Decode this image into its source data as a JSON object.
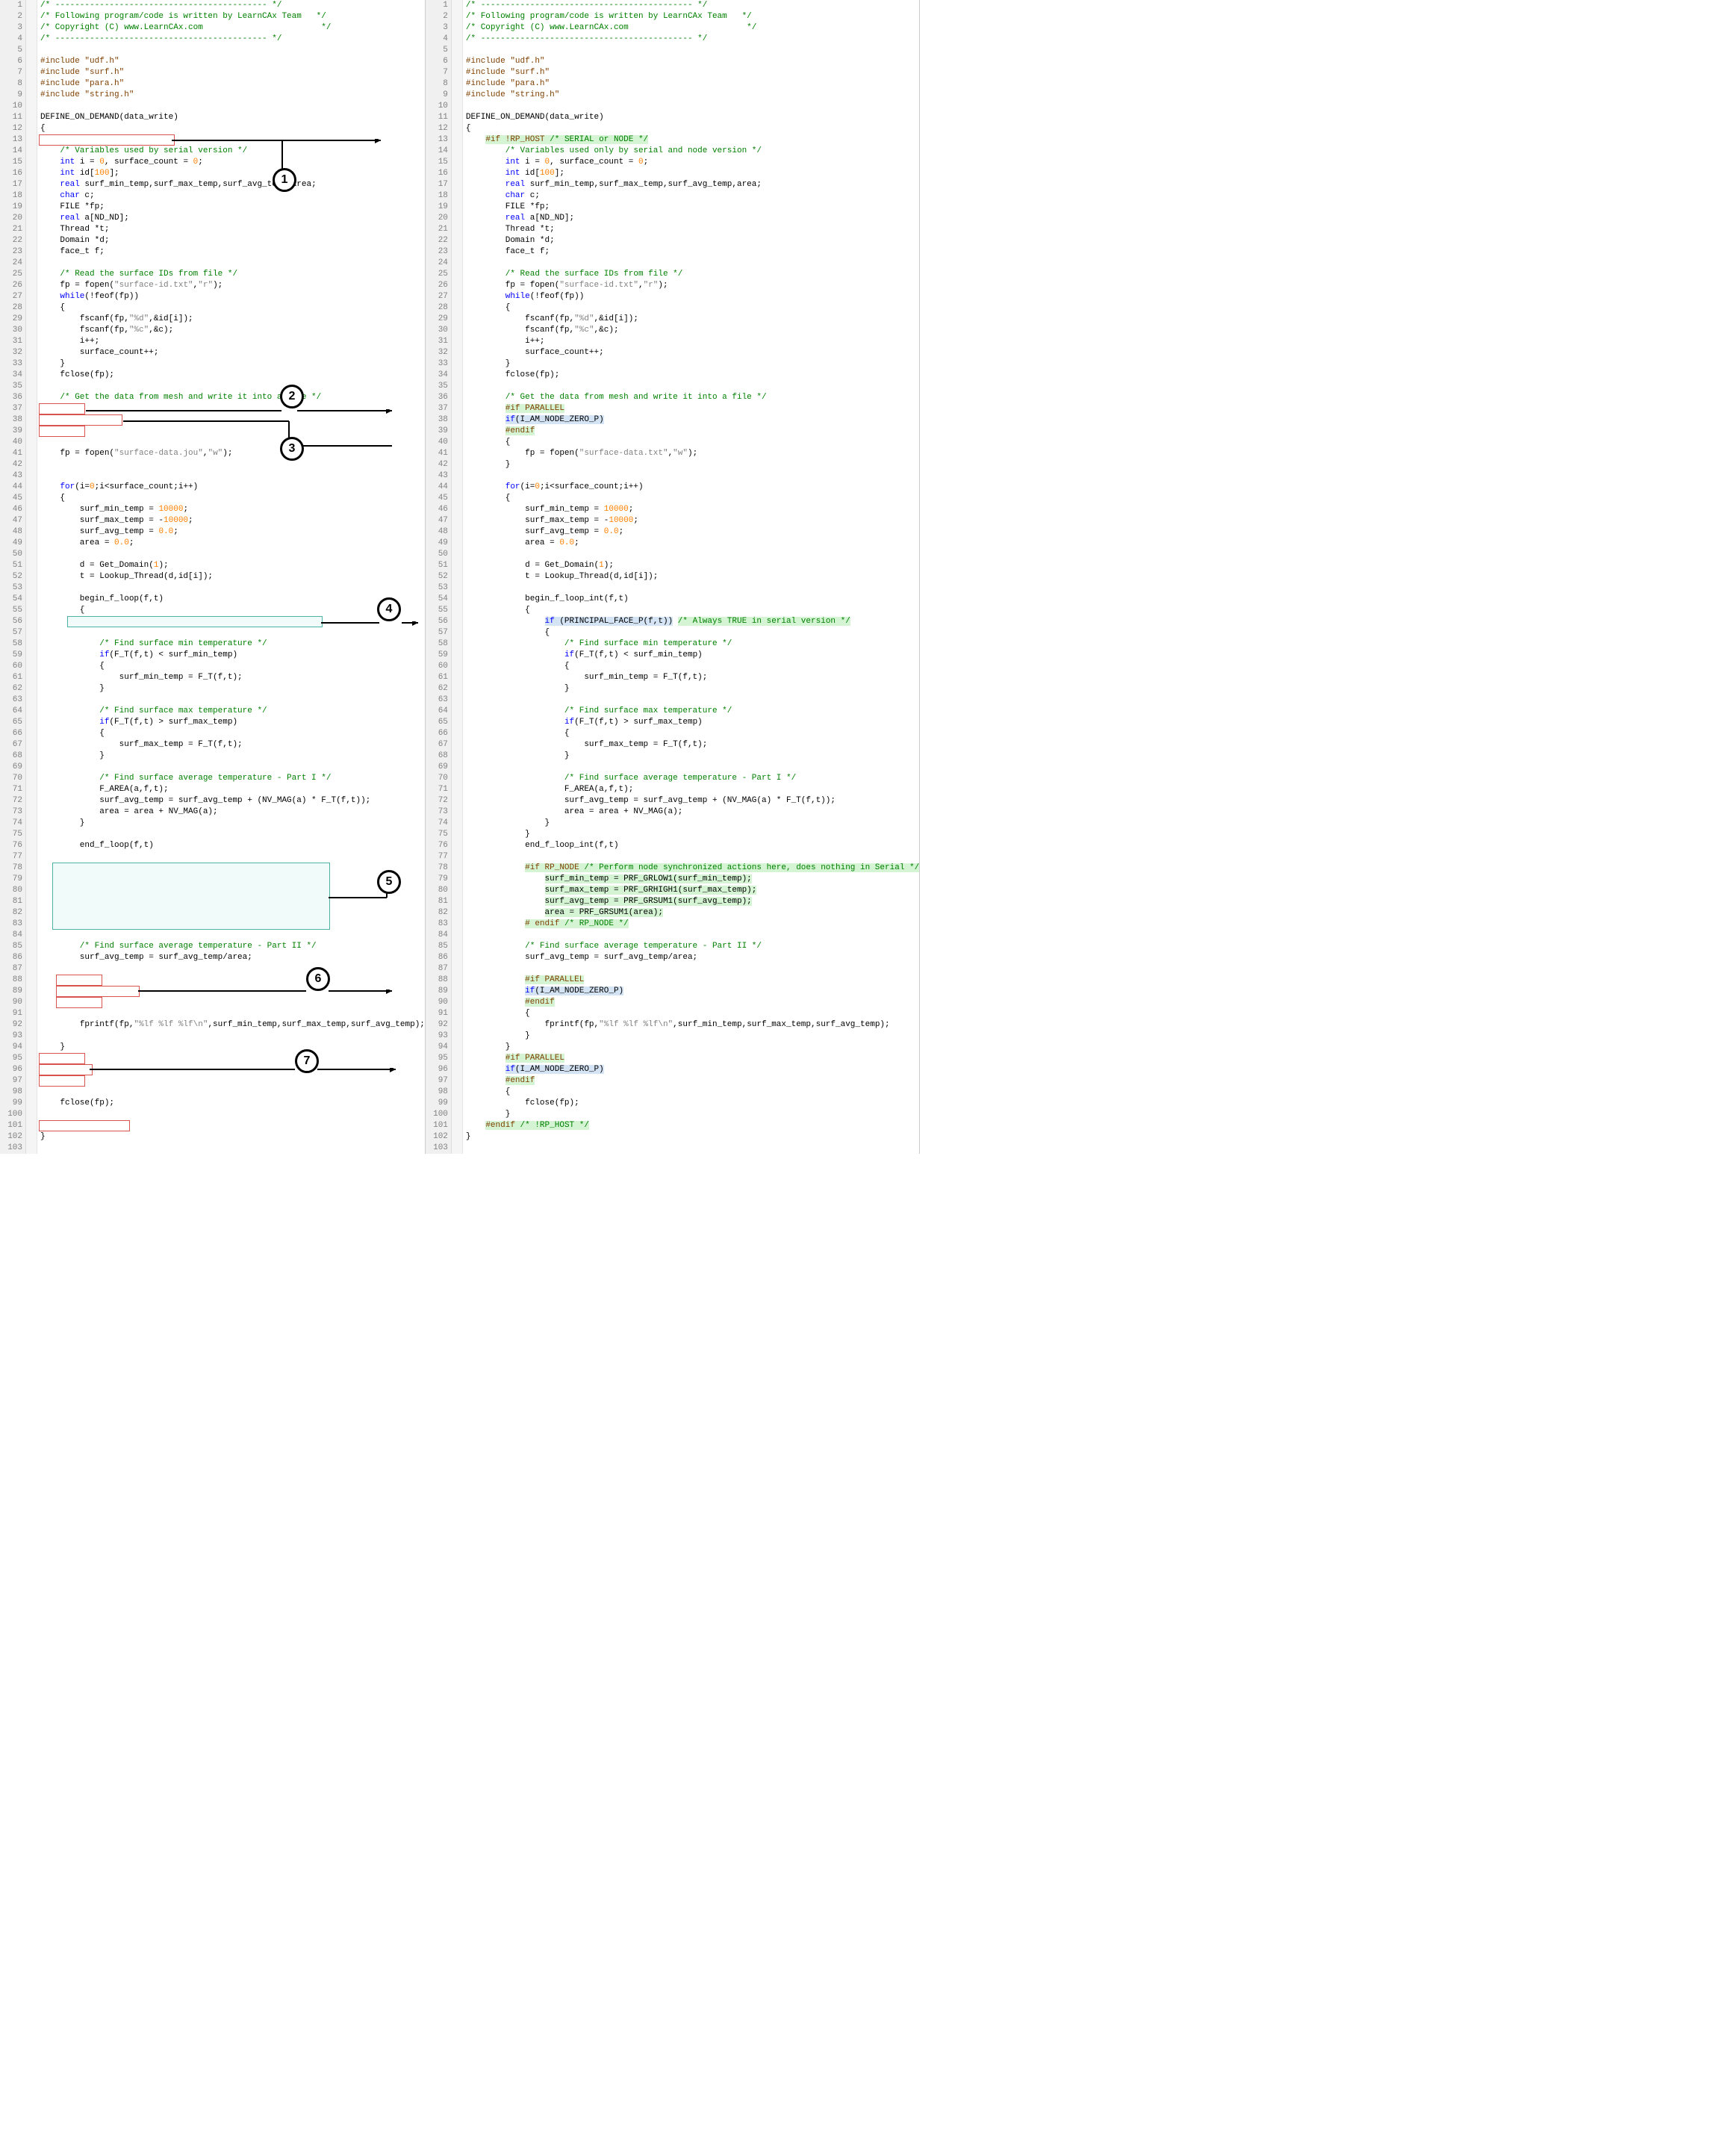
{
  "callouts": [
    "1",
    "2",
    "3",
    "4",
    "5",
    "6",
    "7"
  ],
  "left": [
    {
      "n": 1,
      "t": "/* ------------------------------------------- */",
      "cls": "c-cmt"
    },
    {
      "n": 2,
      "t": "/* Following program/code is written by LearnCAx Team   */",
      "cls": "c-cmt"
    },
    {
      "n": 3,
      "t": "/* Copyright (C) www.LearnCAx.com                        */",
      "cls": "c-cmt"
    },
    {
      "n": 4,
      "t": "/* ------------------------------------------- */",
      "cls": "c-cmt"
    },
    {
      "n": 5,
      "t": ""
    },
    {
      "n": 6,
      "t": "#include \"udf.h\"",
      "cls": "c-pp"
    },
    {
      "n": 7,
      "t": "#include \"surf.h\"",
      "cls": "c-pp"
    },
    {
      "n": 8,
      "t": "#include \"para.h\"",
      "cls": "c-pp"
    },
    {
      "n": 9,
      "t": "#include \"string.h\"",
      "cls": "c-pp"
    },
    {
      "n": 10,
      "t": ""
    },
    {
      "n": 11,
      "t": "DEFINE_ON_DEMAND(data_write)"
    },
    {
      "n": 12,
      "t": "{"
    },
    {
      "n": 13,
      "t": "",
      "box": "red"
    },
    {
      "n": 14,
      "t": "    /* Variables used by serial version */",
      "cls": "c-cmt"
    },
    {
      "n": 15,
      "h": "    <span class='c-kw'>int</span> i = <span class='c-num'>0</span>, surface_count = <span class='c-num'>0</span>;"
    },
    {
      "n": 16,
      "h": "    <span class='c-kw'>int</span> id[<span class='c-num'>100</span>];"
    },
    {
      "n": 17,
      "h": "    <span class='c-kw'>real</span> surf_min_temp,surf_max_temp,surf_avg_temp,area;"
    },
    {
      "n": 18,
      "h": "    <span class='c-kw'>char</span> c;"
    },
    {
      "n": 19,
      "t": "    FILE *fp;"
    },
    {
      "n": 20,
      "h": "    <span class='c-kw'>real</span> a[ND_ND];"
    },
    {
      "n": 21,
      "t": "    Thread *t;"
    },
    {
      "n": 22,
      "t": "    Domain *d;"
    },
    {
      "n": 23,
      "t": "    face_t f;"
    },
    {
      "n": 24,
      "t": ""
    },
    {
      "n": 25,
      "t": "    /* Read the surface IDs from file */",
      "cls": "c-cmt"
    },
    {
      "n": 26,
      "h": "    fp = fopen(<span class='c-str'>\"surface-id.txt\"</span>,<span class='c-str'>\"r\"</span>);"
    },
    {
      "n": 27,
      "h": "    <span class='c-kw'>while</span>(!feof(fp))"
    },
    {
      "n": 28,
      "t": "    {"
    },
    {
      "n": 29,
      "h": "        fscanf(fp,<span class='c-str'>\"%d\"</span>,&id[i]);"
    },
    {
      "n": 30,
      "h": "        fscanf(fp,<span class='c-str'>\"%c\"</span>,&c);"
    },
    {
      "n": 31,
      "t": "        i++;"
    },
    {
      "n": 32,
      "t": "        surface_count++;"
    },
    {
      "n": 33,
      "t": "    }"
    },
    {
      "n": 34,
      "t": "    fclose(fp);"
    },
    {
      "n": 35,
      "t": ""
    },
    {
      "n": 36,
      "t": "    /* Get the data from mesh and write it into a file */",
      "cls": "c-cmt"
    },
    {
      "n": 37,
      "t": "",
      "box": "red"
    },
    {
      "n": 38,
      "t": "",
      "box": "red"
    },
    {
      "n": 39,
      "t": "",
      "box": "red"
    },
    {
      "n": 40,
      "t": ""
    },
    {
      "n": 41,
      "h": "    fp = fopen(<span class='c-str'>\"surface-data.jou\"</span>,<span class='c-str'>\"w\"</span>);"
    },
    {
      "n": 42,
      "t": ""
    },
    {
      "n": 43,
      "t": ""
    },
    {
      "n": 44,
      "h": "    <span class='c-kw'>for</span>(i=<span class='c-num'>0</span>;i&lt;surface_count;i++)"
    },
    {
      "n": 45,
      "t": "    {"
    },
    {
      "n": 46,
      "h": "        surf_min_temp = <span class='c-num'>10000</span>;"
    },
    {
      "n": 47,
      "h": "        surf_max_temp = -<span class='c-num'>10000</span>;"
    },
    {
      "n": 48,
      "h": "        surf_avg_temp = <span class='c-num'>0.0</span>;"
    },
    {
      "n": 49,
      "h": "        area = <span class='c-num'>0.0</span>;"
    },
    {
      "n": 50,
      "t": ""
    },
    {
      "n": 51,
      "h": "        d = Get_Domain(<span class='c-num'>1</span>);"
    },
    {
      "n": 52,
      "t": "        t = Lookup_Thread(d,id[i]);"
    },
    {
      "n": 53,
      "t": ""
    },
    {
      "n": 54,
      "t": "        begin_f_loop(f,t)"
    },
    {
      "n": 55,
      "t": "        {"
    },
    {
      "n": 56,
      "t": "",
      "teal": 1
    },
    {
      "n": 57,
      "t": ""
    },
    {
      "n": 58,
      "t": "            /* Find surface min temperature */",
      "cls": "c-cmt"
    },
    {
      "n": 59,
      "h": "            <span class='c-kw'>if</span>(F_T(f,t) &lt; surf_min_temp)"
    },
    {
      "n": 60,
      "t": "            {"
    },
    {
      "n": 61,
      "t": "                surf_min_temp = F_T(f,t);"
    },
    {
      "n": 62,
      "t": "            }"
    },
    {
      "n": 63,
      "t": ""
    },
    {
      "n": 64,
      "t": "            /* Find surface max temperature */",
      "cls": "c-cmt"
    },
    {
      "n": 65,
      "h": "            <span class='c-kw'>if</span>(F_T(f,t) &gt; surf_max_temp)"
    },
    {
      "n": 66,
      "t": "            {"
    },
    {
      "n": 67,
      "t": "                surf_max_temp = F_T(f,t);"
    },
    {
      "n": 68,
      "t": "            }"
    },
    {
      "n": 69,
      "t": ""
    },
    {
      "n": 70,
      "t": "            /* Find surface average temperature - Part I */",
      "cls": "c-cmt"
    },
    {
      "n": 71,
      "t": "            F_AREA(a,f,t);"
    },
    {
      "n": 72,
      "t": "            surf_avg_temp = surf_avg_temp + (NV_MAG(a) * F_T(f,t));"
    },
    {
      "n": 73,
      "t": "            area = area + NV_MAG(a);"
    },
    {
      "n": 74,
      "t": "        }"
    },
    {
      "n": 75,
      "t": ""
    },
    {
      "n": 76,
      "t": "        end_f_loop(f,t)"
    },
    {
      "n": 77,
      "t": ""
    },
    {
      "n": 78,
      "t": "",
      "teal": 1
    },
    {
      "n": 79,
      "t": ""
    },
    {
      "n": 80,
      "t": ""
    },
    {
      "n": 81,
      "t": ""
    },
    {
      "n": 82,
      "t": ""
    },
    {
      "n": 83,
      "t": ""
    },
    {
      "n": 84,
      "t": ""
    },
    {
      "n": 85,
      "t": "        /* Find surface average temperature - Part II */",
      "cls": "c-cmt"
    },
    {
      "n": 86,
      "t": "        surf_avg_temp = surf_avg_temp/area;"
    },
    {
      "n": 87,
      "t": ""
    },
    {
      "n": 88,
      "t": "",
      "box": "red"
    },
    {
      "n": 89,
      "t": "",
      "box": "red"
    },
    {
      "n": 90,
      "t": "",
      "box": "red"
    },
    {
      "n": 91,
      "t": ""
    },
    {
      "n": 92,
      "h": "        fprintf(fp,<span class='c-str'>\"%lf %lf %lf\\n\"</span>,surf_min_temp,surf_max_temp,surf_avg_temp);"
    },
    {
      "n": 93,
      "t": ""
    },
    {
      "n": 94,
      "t": "    }"
    },
    {
      "n": 95,
      "t": "",
      "box": "red"
    },
    {
      "n": 96,
      "t": "",
      "box": "red"
    },
    {
      "n": 97,
      "t": "",
      "box": "red"
    },
    {
      "n": 98,
      "t": ""
    },
    {
      "n": 99,
      "t": "    fclose(fp);"
    },
    {
      "n": 100,
      "t": ""
    },
    {
      "n": 101,
      "t": "",
      "box": "red"
    },
    {
      "n": 102,
      "t": "}"
    },
    {
      "n": 103,
      "t": ""
    }
  ],
  "right": [
    {
      "n": 1,
      "t": "/* ------------------------------------------- */",
      "cls": "c-cmt"
    },
    {
      "n": 2,
      "t": "/* Following program/code is written by LearnCAx Team   */",
      "cls": "c-cmt"
    },
    {
      "n": 3,
      "t": "/* Copyright (C) www.LearnCAx.com                        */",
      "cls": "c-cmt"
    },
    {
      "n": 4,
      "t": "/* ------------------------------------------- */",
      "cls": "c-cmt"
    },
    {
      "n": 5,
      "t": ""
    },
    {
      "n": 6,
      "t": "#include \"udf.h\"",
      "cls": "c-pp"
    },
    {
      "n": 7,
      "t": "#include \"surf.h\"",
      "cls": "c-pp"
    },
    {
      "n": 8,
      "t": "#include \"para.h\"",
      "cls": "c-pp"
    },
    {
      "n": 9,
      "t": "#include \"string.h\"",
      "cls": "c-pp"
    },
    {
      "n": 10,
      "t": ""
    },
    {
      "n": 11,
      "t": "DEFINE_ON_DEMAND(data_write)"
    },
    {
      "n": 12,
      "t": "{"
    },
    {
      "n": 13,
      "h": "    <span class='hl-g'>#if !RP_HOST <span class='c-cmt'>/* SERIAL or NODE */</span></span>",
      "cls": "c-pp"
    },
    {
      "n": 14,
      "t": "        /* Variables used only by serial and node version */",
      "cls": "c-cmt"
    },
    {
      "n": 15,
      "h": "        <span class='c-kw'>int</span> i = <span class='c-num'>0</span>, surface_count = <span class='c-num'>0</span>;"
    },
    {
      "n": 16,
      "h": "        <span class='c-kw'>int</span> id[<span class='c-num'>100</span>];"
    },
    {
      "n": 17,
      "h": "        <span class='c-kw'>real</span> surf_min_temp,surf_max_temp,surf_avg_temp,area;"
    },
    {
      "n": 18,
      "h": "        <span class='c-kw'>char</span> c;"
    },
    {
      "n": 19,
      "t": "        FILE *fp;"
    },
    {
      "n": 20,
      "h": "        <span class='c-kw'>real</span> a[ND_ND];"
    },
    {
      "n": 21,
      "t": "        Thread *t;"
    },
    {
      "n": 22,
      "t": "        Domain *d;"
    },
    {
      "n": 23,
      "t": "        face_t f;"
    },
    {
      "n": 24,
      "t": ""
    },
    {
      "n": 25,
      "t": "        /* Read the surface IDs from file */",
      "cls": "c-cmt"
    },
    {
      "n": 26,
      "h": "        fp = fopen(<span class='c-str'>\"surface-id.txt\"</span>,<span class='c-str'>\"r\"</span>);"
    },
    {
      "n": 27,
      "h": "        <span class='c-kw'>while</span>(!feof(fp))"
    },
    {
      "n": 28,
      "t": "        {"
    },
    {
      "n": 29,
      "h": "            fscanf(fp,<span class='c-str'>\"%d\"</span>,&id[i]);"
    },
    {
      "n": 30,
      "h": "            fscanf(fp,<span class='c-str'>\"%c\"</span>,&c);"
    },
    {
      "n": 31,
      "t": "            i++;"
    },
    {
      "n": 32,
      "t": "            surface_count++;"
    },
    {
      "n": 33,
      "t": "        }"
    },
    {
      "n": 34,
      "t": "        fclose(fp);"
    },
    {
      "n": 35,
      "t": ""
    },
    {
      "n": 36,
      "t": "        /* Get the data from mesh and write it into a file */",
      "cls": "c-cmt"
    },
    {
      "n": 37,
      "h": "        <span class='hl-g'>#if PARALLEL</span>",
      "cls": "c-pp"
    },
    {
      "n": 38,
      "h": "        <span class='hl-b'><span class='c-kw'>if</span>(I_AM_NODE_ZERO_P)</span>"
    },
    {
      "n": 39,
      "h": "        <span class='hl-g'>#endif</span>",
      "cls": "c-pp"
    },
    {
      "n": 40,
      "t": "        {"
    },
    {
      "n": 41,
      "h": "            fp = fopen(<span class='c-str'>\"surface-data.txt\"</span>,<span class='c-str'>\"w\"</span>);"
    },
    {
      "n": 42,
      "t": "        }"
    },
    {
      "n": 43,
      "t": ""
    },
    {
      "n": 44,
      "h": "        <span class='c-kw'>for</span>(i=<span class='c-num'>0</span>;i&lt;surface_count;i++)"
    },
    {
      "n": 45,
      "t": "        {"
    },
    {
      "n": 46,
      "h": "            surf_min_temp = <span class='c-num'>10000</span>;"
    },
    {
      "n": 47,
      "h": "            surf_max_temp = -<span class='c-num'>10000</span>;"
    },
    {
      "n": 48,
      "h": "            surf_avg_temp = <span class='c-num'>0.0</span>;"
    },
    {
      "n": 49,
      "h": "            area = <span class='c-num'>0.0</span>;"
    },
    {
      "n": 50,
      "t": ""
    },
    {
      "n": 51,
      "h": "            d = Get_Domain(<span class='c-num'>1</span>);"
    },
    {
      "n": 52,
      "t": "            t = Lookup_Thread(d,id[i]);"
    },
    {
      "n": 53,
      "t": ""
    },
    {
      "n": 54,
      "t": "            begin_f_loop_int(f,t)"
    },
    {
      "n": 55,
      "t": "            {"
    },
    {
      "n": 56,
      "h": "                <span class='hl-b'><span class='c-kw'>if</span> (PRINCIPAL_FACE_P(f,t))</span> <span class='c-cmt hl-g'>/* Always TRUE in serial version */</span>"
    },
    {
      "n": 57,
      "t": "                {"
    },
    {
      "n": 58,
      "t": "                    /* Find surface min temperature */",
      "cls": "c-cmt"
    },
    {
      "n": 59,
      "h": "                    <span class='c-kw'>if</span>(F_T(f,t) &lt; surf_min_temp)"
    },
    {
      "n": 60,
      "t": "                    {"
    },
    {
      "n": 61,
      "t": "                        surf_min_temp = F_T(f,t);"
    },
    {
      "n": 62,
      "t": "                    }"
    },
    {
      "n": 63,
      "t": ""
    },
    {
      "n": 64,
      "t": "                    /* Find surface max temperature */",
      "cls": "c-cmt"
    },
    {
      "n": 65,
      "h": "                    <span class='c-kw'>if</span>(F_T(f,t) &gt; surf_max_temp)"
    },
    {
      "n": 66,
      "t": "                    {"
    },
    {
      "n": 67,
      "t": "                        surf_max_temp = F_T(f,t);"
    },
    {
      "n": 68,
      "t": "                    }"
    },
    {
      "n": 69,
      "t": ""
    },
    {
      "n": 70,
      "t": "                    /* Find surface average temperature - Part I */",
      "cls": "c-cmt"
    },
    {
      "n": 71,
      "t": "                    F_AREA(a,f,t);"
    },
    {
      "n": 72,
      "t": "                    surf_avg_temp = surf_avg_temp + (NV_MAG(a) * F_T(f,t));"
    },
    {
      "n": 73,
      "t": "                    area = area + NV_MAG(a);"
    },
    {
      "n": 74,
      "t": "                }"
    },
    {
      "n": 75,
      "t": "            }"
    },
    {
      "n": 76,
      "t": "            end_f_loop_int(f,t)"
    },
    {
      "n": 77,
      "t": ""
    },
    {
      "n": 78,
      "h": "            <span class='hl-g'>#if RP_NODE <span class='c-cmt'>/* Perform node synchronized actions here, does nothing in Serial */</span></span>",
      "cls": "c-pp"
    },
    {
      "n": 79,
      "h": "                <span class='hl-g'>surf_min_temp = PRF_GRLOW1(surf_min_temp);</span>"
    },
    {
      "n": 80,
      "h": "                <span class='hl-g'>surf_max_temp = PRF_GRHIGH1(surf_max_temp);</span>"
    },
    {
      "n": 81,
      "h": "                <span class='hl-g'>surf_avg_temp = PRF_GRSUM1(surf_avg_temp);</span>"
    },
    {
      "n": 82,
      "h": "                <span class='hl-g'>area = PRF_GRSUM1(area);</span>"
    },
    {
      "n": 83,
      "h": "            <span class='hl-g'># endif <span class='c-cmt'>/* RP_NODE */</span></span>",
      "cls": "c-pp"
    },
    {
      "n": 84,
      "t": ""
    },
    {
      "n": 85,
      "t": "            /* Find surface average temperature - Part II */",
      "cls": "c-cmt"
    },
    {
      "n": 86,
      "t": "            surf_avg_temp = surf_avg_temp/area;"
    },
    {
      "n": 87,
      "t": ""
    },
    {
      "n": 88,
      "h": "            <span class='hl-g'>#if PARALLEL</span>",
      "cls": "c-pp"
    },
    {
      "n": 89,
      "h": "            <span class='hl-b'><span class='c-kw'>if</span>(I_AM_NODE_ZERO_P)</span>"
    },
    {
      "n": 90,
      "h": "            <span class='hl-g'>#endif</span>",
      "cls": "c-pp"
    },
    {
      "n": 91,
      "t": "            {"
    },
    {
      "n": 92,
      "h": "                fprintf(fp,<span class='c-str'>\"%lf %lf %lf\\n\"</span>,surf_min_temp,surf_max_temp,surf_avg_temp);"
    },
    {
      "n": 93,
      "t": "            }"
    },
    {
      "n": 94,
      "t": "        }"
    },
    {
      "n": 95,
      "h": "        <span class='hl-g'>#if PARALLEL</span>",
      "cls": "c-pp"
    },
    {
      "n": 96,
      "h": "        <span class='hl-b'><span class='c-kw'>if</span>(I_AM_NODE_ZERO_P)</span>"
    },
    {
      "n": 97,
      "h": "        <span class='hl-g'>#endif</span>",
      "cls": "c-pp"
    },
    {
      "n": 98,
      "t": "        {"
    },
    {
      "n": 99,
      "t": "            fclose(fp);"
    },
    {
      "n": 100,
      "t": "        }"
    },
    {
      "n": 101,
      "h": "    <span class='hl-g'>#endif <span class='c-cmt'>/* !RP_HOST */</span></span>",
      "cls": "c-pp"
    },
    {
      "n": 102,
      "t": "}"
    },
    {
      "n": 103,
      "t": ""
    }
  ]
}
